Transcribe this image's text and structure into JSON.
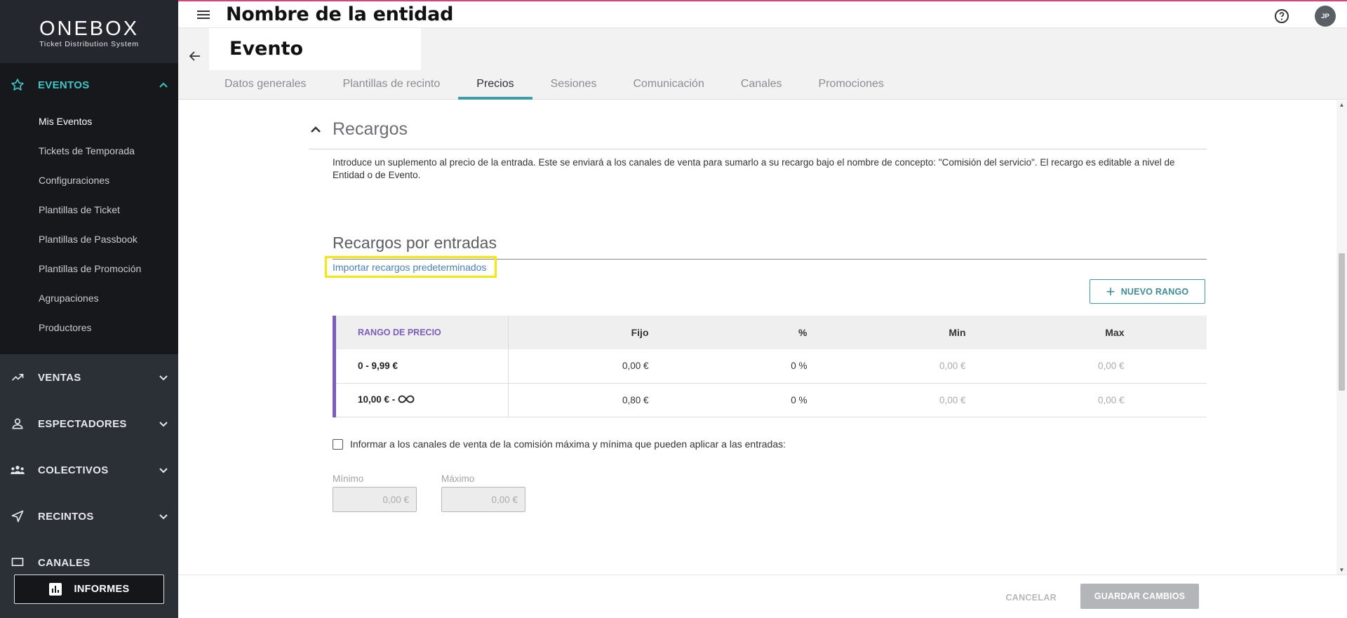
{
  "app": {
    "logo": "ONEBOX",
    "logo_subtitle": "Ticket Distribution System",
    "accent_color": "#3ec6c8"
  },
  "topbar": {
    "entity_name": "Nombre de la entidad",
    "avatar_initials": "JP"
  },
  "header": {
    "event_title": "Evento",
    "tabs": [
      {
        "label": "Datos generales"
      },
      {
        "label": "Plantillas de recinto"
      },
      {
        "label": "Precios",
        "active": true
      },
      {
        "label": "Sesiones"
      },
      {
        "label": "Comunicación"
      },
      {
        "label": "Canales"
      },
      {
        "label": "Promociones"
      }
    ]
  },
  "sidebar": {
    "eventos": {
      "label": "EVENTOS",
      "items": [
        {
          "label": "Mis Eventos"
        },
        {
          "label": "Tickets de Temporada"
        },
        {
          "label": "Configuraciones"
        },
        {
          "label": "Plantillas de Ticket"
        },
        {
          "label": "Plantillas de Passbook"
        },
        {
          "label": "Plantillas de Promoción"
        },
        {
          "label": "Agrupaciones"
        },
        {
          "label": "Productores"
        }
      ]
    },
    "sections": [
      {
        "label": "VENTAS"
      },
      {
        "label": "ESPECTADORES"
      },
      {
        "label": "COLECTIVOS"
      },
      {
        "label": "RECINTOS"
      },
      {
        "label": "CANALES"
      }
    ],
    "informes_label": "INFORMES"
  },
  "content": {
    "section_title": "Recargos",
    "description": "Introduce un suplemento al precio de la entrada. Este se enviará a los canales de venta para sumarlo a su recargo bajo el nombre de concepto: \"Comisión del servicio\". El recargo es editable a nivel de Entidad o de Evento.",
    "subsection_title": "Recargos por entradas",
    "import_link": "Importar recargos predeterminados",
    "new_range_button": "NUEVO RANGO",
    "table": {
      "headers": {
        "range": "RANGO DE PRECIO",
        "fixed": "Fijo",
        "percent": "%",
        "min": "Min",
        "max": "Max"
      },
      "rows": [
        {
          "range": "0 - 9,99 €",
          "fixed": "0,00 €",
          "percent": "0 %",
          "min": "0,00 €",
          "max": "0,00 €"
        },
        {
          "range": "10,00 € -",
          "fixed": "0,80 €",
          "percent": "0 %",
          "min": "0,00 €",
          "max": "0,00 €"
        }
      ]
    },
    "checkbox_label": "Informar a los canales de venta de la comisión máxima y mínima que pueden aplicar a las entradas:",
    "min_label": "Mínimo",
    "min_value": "0,00 €",
    "max_label": "Máximo",
    "max_value": "0,00 €"
  },
  "footer": {
    "cancel": "CANCELAR",
    "save": "GUARDAR CAMBIOS"
  }
}
